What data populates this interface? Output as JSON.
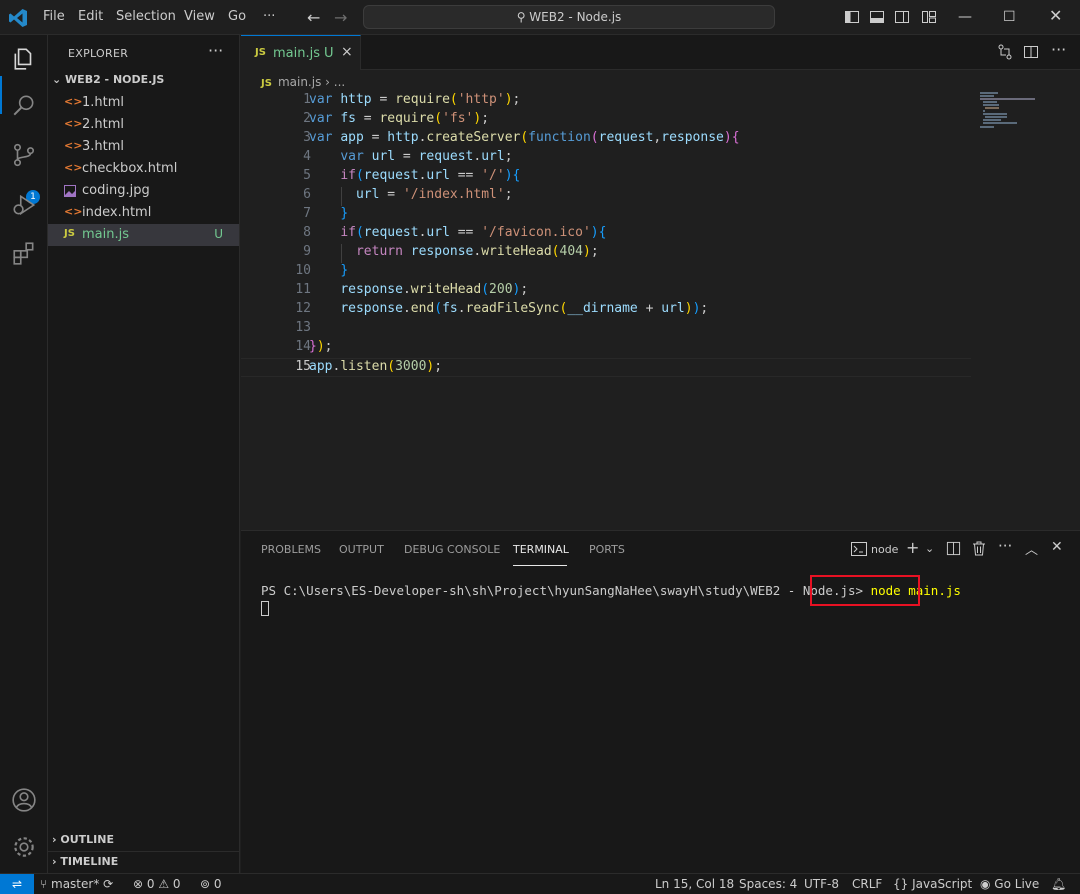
{
  "titlebar": {
    "menus": [
      "File",
      "Edit",
      "Selection",
      "View",
      "Go",
      "···"
    ],
    "command_center": "WEB2 - Node.js",
    "accent": "#0078d4"
  },
  "activitybar": {
    "items": [
      "files-icon",
      "search-icon",
      "source-control-icon",
      "run-debug-icon",
      "extensions-icon"
    ],
    "scm_badge": "1",
    "bottom": [
      "account-icon",
      "manage-gear-icon"
    ]
  },
  "sidebar": {
    "title": "EXPLORER",
    "more": "···",
    "folder": "WEB2 - NODE.JS",
    "files": [
      {
        "name": "1.html",
        "icon": "<>",
        "status": ""
      },
      {
        "name": "2.html",
        "icon": "<>",
        "status": ""
      },
      {
        "name": "3.html",
        "icon": "<>",
        "status": ""
      },
      {
        "name": "checkbox.html",
        "icon": "<>",
        "status": ""
      },
      {
        "name": "coding.jpg",
        "icon": "image",
        "status": ""
      },
      {
        "name": "index.html",
        "icon": "<>",
        "status": ""
      },
      {
        "name": "main.js",
        "icon": "JS",
        "status": "U"
      }
    ],
    "outline": "OUTLINE",
    "timeline": "TIMELINE"
  },
  "editor": {
    "tab": {
      "icon": "JS",
      "name": "main.js",
      "status": "U",
      "close": "×"
    },
    "breadcrumb": {
      "icon": "JS",
      "file": "main.js",
      "rest": "..."
    },
    "line_numbers": [
      "1",
      "2",
      "3",
      "4",
      "5",
      "6",
      "7",
      "8",
      "9",
      "10",
      "11",
      "12",
      "13",
      "14",
      "15"
    ],
    "active_line": "15",
    "code_lines": [
      "var http = require('http');",
      "var fs = require('fs');",
      "var app = http.createServer(function(request,response){",
      "    var url = request.url;",
      "    if(request.url == '/'){",
      "      url = '/index.html';",
      "    }",
      "    if(request.url == '/favicon.ico'){",
      "      return response.writeHead(404);",
      "    }",
      "    response.writeHead(200);",
      "    response.end(fs.readFileSync(__dirname + url));",
      "",
      "});",
      "app.listen(3000);"
    ]
  },
  "panel": {
    "tabs": [
      "PROBLEMS",
      "OUTPUT",
      "DEBUG CONSOLE",
      "TERMINAL",
      "PORTS"
    ],
    "active_tab": "TERMINAL",
    "terminal_name": "node",
    "prompt": "PS C:\\Users\\ES-Developer-sh\\sh\\Project\\hyunSangNaHee\\swayH\\study\\WEB2 - Node.js>",
    "command": " node main.js",
    "highlight_color": "#e81123"
  },
  "statusbar": {
    "branch": "master*",
    "errors": "0",
    "warnings": "0",
    "ports": "0",
    "position": "Ln 15, Col 18",
    "spaces": "Spaces: 4",
    "encoding": "UTF-8",
    "eol": "CRLF",
    "language": "JavaScript",
    "golive": "Go Live"
  }
}
